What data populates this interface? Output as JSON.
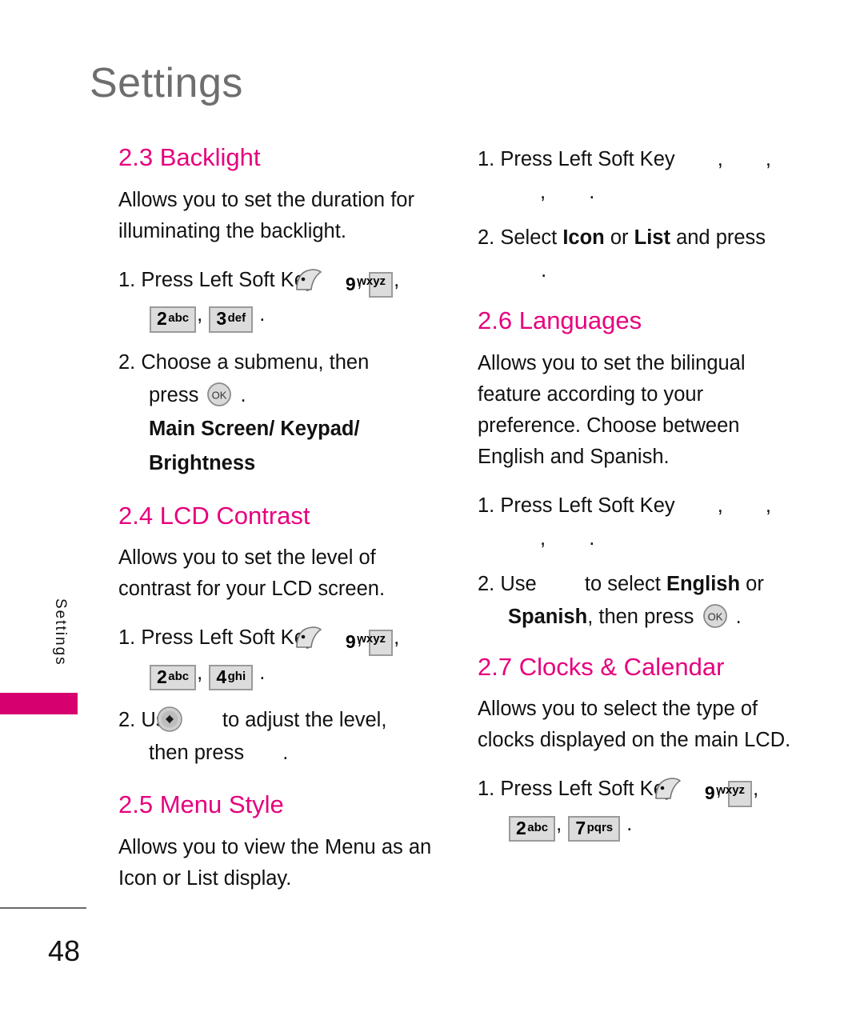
{
  "page": {
    "title": "Settings",
    "side_tab_label": "Settings",
    "number": "48",
    "accent_color": "#E6007E",
    "tab_bar_color": "#D6006E",
    "title_color": "#6E6E6E"
  },
  "icons": {
    "soft_key": "left-soft-key-icon",
    "ok_key": "ok-key-icon",
    "nav_key": "navigation-left-right-icon"
  },
  "keys": {
    "k2": {
      "num": "2",
      "letters": "abc"
    },
    "k3": {
      "num": "3",
      "letters": "def"
    },
    "k4": {
      "num": "4",
      "letters": "ghi"
    },
    "k7": {
      "num": "7",
      "letters": "pqrs"
    },
    "k9": {
      "num": "9",
      "letters": "wxyz"
    }
  },
  "sections": {
    "backlight": {
      "heading": "2.3 Backlight",
      "description": "Allows you to set the duration for illuminating the backlight.",
      "step1_label": "1. Press Left Soft Key",
      "step2_label": "2. Choose a submenu, then",
      "step2_cont": "press",
      "submenu_items": "Main Screen/ Keypad/",
      "submenu_items_2": "Brightness"
    },
    "lcd_contrast": {
      "heading": "2.4 LCD Contrast",
      "description": "Allows you to set the level of contrast for your LCD screen.",
      "step1_label": "1. Press Left Soft Key",
      "step2_label": "2. Use",
      "step2_mid": "to adjust the level,",
      "step2_cont": "then press"
    },
    "menu_style": {
      "heading": "2.5 Menu Style",
      "description": "Allows you to view the Menu as an Icon or List display.",
      "step1_label": "1. Press Left Soft Key",
      "step2_pre": "2. Select",
      "step2_opt1": "Icon",
      "step2_mid": "or",
      "step2_opt2": "List",
      "step2_post": "and press"
    },
    "languages": {
      "heading": "2.6 Languages",
      "description": "Allows you to set the bilingual feature according to your preference. Choose between English and Spanish.",
      "step1_label": "1. Press Left Soft Key",
      "step2_pre": "2. Use",
      "step2_mid": "to select",
      "step2_opt1": "English",
      "step2_or": "or",
      "step2_opt2": "Spanish",
      "step2_post": ", then press"
    },
    "clocks_calendar": {
      "heading": "2.7 Clocks & Calendar",
      "description": "Allows you to select the type of clocks displayed on the main LCD.",
      "step1_label": "1. Press Left Soft Key"
    }
  },
  "punct": {
    "comma": ",",
    "period": "."
  }
}
